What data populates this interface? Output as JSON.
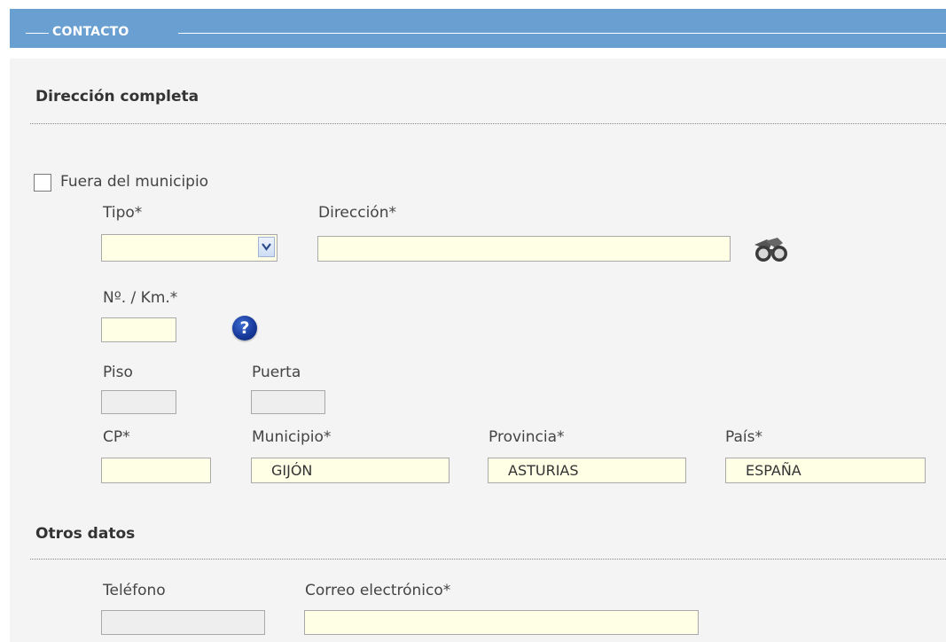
{
  "header": {
    "title": "CONTACTO"
  },
  "address_section": {
    "title": "Dirección completa",
    "outside_municipality_label": "Fuera del municipio",
    "outside_municipality_checked": false,
    "tipo": {
      "label": "Tipo*",
      "value": ""
    },
    "direccion": {
      "label": "Dirección*",
      "value": ""
    },
    "numero": {
      "label": "Nº. / Km.*",
      "value": ""
    },
    "piso": {
      "label": "Piso",
      "value": ""
    },
    "puerta": {
      "label": "Puerta",
      "value": ""
    },
    "cp": {
      "label": "CP*",
      "value": ""
    },
    "municipio": {
      "label": "Municipio*",
      "value": "GIJÓN"
    },
    "provincia": {
      "label": "Provincia*",
      "value": "ASTURIAS"
    },
    "pais": {
      "label": "País*",
      "value": "ESPAÑA"
    }
  },
  "other_section": {
    "title": "Otros datos",
    "telefono": {
      "label": "Teléfono",
      "value": ""
    },
    "correo": {
      "label": "Correo electrónico*",
      "value": ""
    }
  },
  "icons": {
    "search": "binoculars-icon",
    "help": "help-icon",
    "help_glyph": "?"
  }
}
